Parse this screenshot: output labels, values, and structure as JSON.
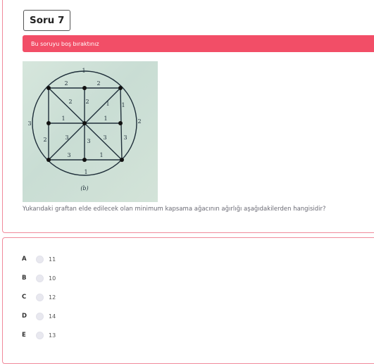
{
  "question": {
    "title": "Soru 7",
    "alert": "Bu soruyu boş bıraktınız",
    "text": "Yukarıdaki graftan elde edilecek olan minimum kapsama ağacının ağırlığı aşağıdakilerden hangisidir?",
    "figure": {
      "caption": "(b)",
      "edge_labels": [
        "1",
        "2",
        "2",
        "2",
        "2",
        "1",
        "1",
        "3",
        "1",
        "1",
        "2",
        "2",
        "3",
        "3",
        "3",
        "3",
        "3",
        "1"
      ]
    }
  },
  "options": [
    {
      "letter": "A",
      "value": "11"
    },
    {
      "letter": "B",
      "value": "10"
    },
    {
      "letter": "C",
      "value": "12"
    },
    {
      "letter": "D",
      "value": "14"
    },
    {
      "letter": "E",
      "value": "13"
    }
  ],
  "colors": {
    "alert": "#f24e67",
    "card_border": "#f08a9b"
  }
}
